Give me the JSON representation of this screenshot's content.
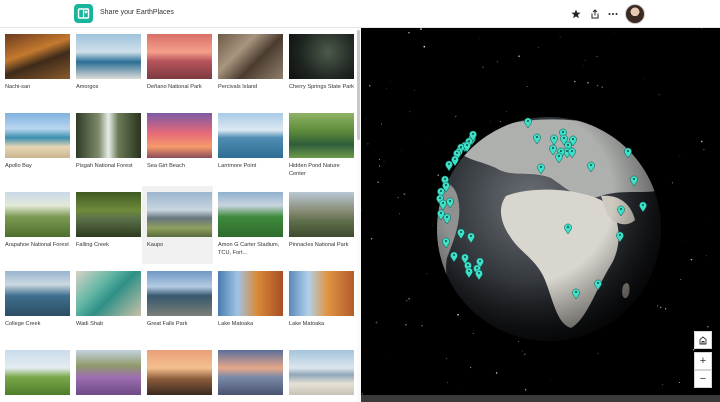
{
  "app": {
    "title": "Share your EarthPlaces",
    "logo_icon": "map-book-icon",
    "accent": "#19b59a"
  },
  "toolbar": {
    "icons": [
      "star-icon",
      "share-icon",
      "more-icon"
    ],
    "avatar": "user-avatar"
  },
  "places": [
    {
      "name": "Nachi-san",
      "scene": "waterfall-autumn"
    },
    {
      "name": "Amorgos",
      "scene": "coast-cliff"
    },
    {
      "name": "Deñano National Park",
      "scene": "pink-sunset-lake"
    },
    {
      "name": "Percivals Island",
      "scene": "driftwood"
    },
    {
      "name": "Cherry Springs State Park",
      "scene": "night-sky"
    },
    {
      "name": "Apollo Bay",
      "scene": "beach"
    },
    {
      "name": "Pisgah National Forest",
      "scene": "forest-waterfall"
    },
    {
      "name": "Sea Girt Beach",
      "scene": "pink-sky"
    },
    {
      "name": "Larrimore Point",
      "scene": "pier-lake"
    },
    {
      "name": "Hidden Pond Nature Center",
      "scene": "green-pond"
    },
    {
      "name": "Arapahoe National Forest",
      "scene": "meadow-hills"
    },
    {
      "name": "Falling Creek",
      "scene": "creek-canopy"
    },
    {
      "name": "Kaupo",
      "scene": "mountain-sea"
    },
    {
      "name": "Amon G Carter Stadium, TCU, Fort...",
      "scene": "stadium"
    },
    {
      "name": "Pinnacles National Park",
      "scene": "rocky-hills"
    },
    {
      "name": "College Creek",
      "scene": "blue-lake"
    },
    {
      "name": "Wadi Shab",
      "scene": "turquoise-pool"
    },
    {
      "name": "Great Falls Park",
      "scene": "river-rocks"
    },
    {
      "name": "Lake Matoaka",
      "scene": "autumn-lake"
    },
    {
      "name": "Lake Matoaka",
      "scene": "autumn-lake-2"
    },
    {
      "name": "",
      "scene": "green-field"
    },
    {
      "name": "",
      "scene": "heather"
    },
    {
      "name": "",
      "scene": "sunset-plain"
    },
    {
      "name": "",
      "scene": "sunset-water"
    },
    {
      "name": "",
      "scene": "beach-sand"
    }
  ],
  "map": {
    "buttons": [
      "home-icon",
      "zoom-in-icon",
      "zoom-out-icon"
    ],
    "zoom_in": "+",
    "zoom_out": "−",
    "marker_color": "#3ee0c8"
  }
}
